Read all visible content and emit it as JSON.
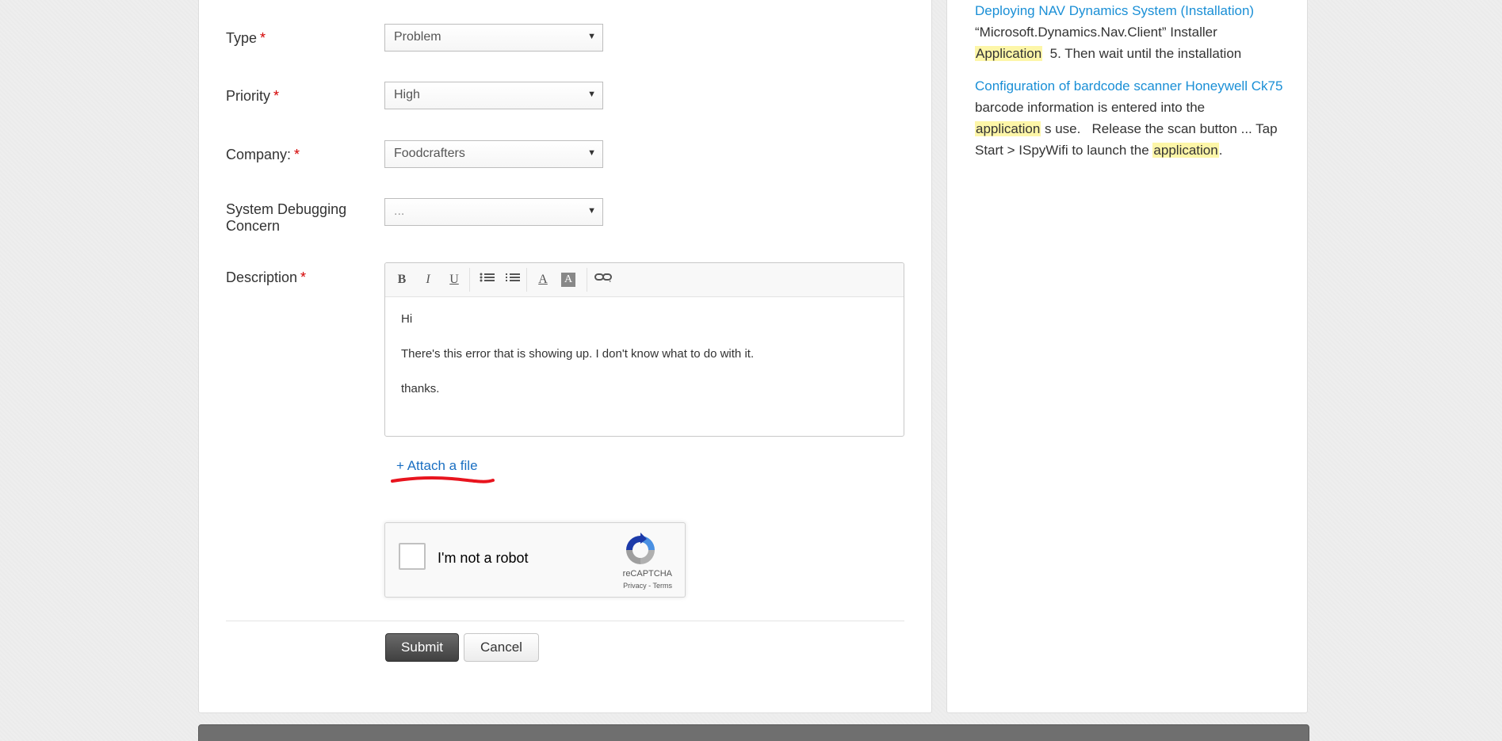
{
  "form": {
    "type": {
      "label": "Type",
      "required_mark": "*",
      "value": "Problem"
    },
    "priority": {
      "label": "Priority",
      "required_mark": "*",
      "value": "High"
    },
    "company": {
      "label": "Company:",
      "required_mark": "*",
      "value": "Foodcrafters"
    },
    "debug": {
      "label_line1": "System Debugging",
      "label_line2": "Concern",
      "value": "..."
    },
    "description": {
      "label": "Description",
      "required_mark": "*",
      "toolbar": {
        "bold": "B",
        "italic": "I",
        "underline": "U",
        "unordered_list": "bulleted-list-icon",
        "ordered_list": "numbered-list-icon",
        "text_color": "A",
        "bg_color": "A",
        "link": "link-icon"
      },
      "body": [
        "Hi",
        "There's this error that is showing up. I don't know what to do with it.",
        "thanks."
      ]
    },
    "attach_label": "+ Attach a file",
    "captcha": {
      "label": "I'm not a robot",
      "brand": "reCAPTCHA",
      "privacy": "Privacy",
      "separator": " - ",
      "terms": "Terms"
    },
    "submit_label": "Submit",
    "cancel_label": "Cancel"
  },
  "sidebar": {
    "articles": [
      {
        "title": "Deploying NAV Dynamics System (Installation)",
        "snippet_a": "“Microsoft.Dynamics.Nav.Client” Installer",
        "snippet_hl": "Application",
        "snippet_b": "  5. Then wait until the installation"
      },
      {
        "title": "Configuration of bardcode scanner Honeywell Ck75",
        "snippet_a": "barcode information is entered into the",
        "snippet_hl1": "application",
        "snippet_b": " s use.   Release the scan button ... Tap Start > ISpyWifi to launch the ",
        "snippet_hl2": "application",
        "snippet_c": "."
      }
    ]
  },
  "colors": {
    "link": "#1a8fd6",
    "required": "#d40000",
    "highlight": "#fdf6a8",
    "annotation": "#e8141e"
  }
}
